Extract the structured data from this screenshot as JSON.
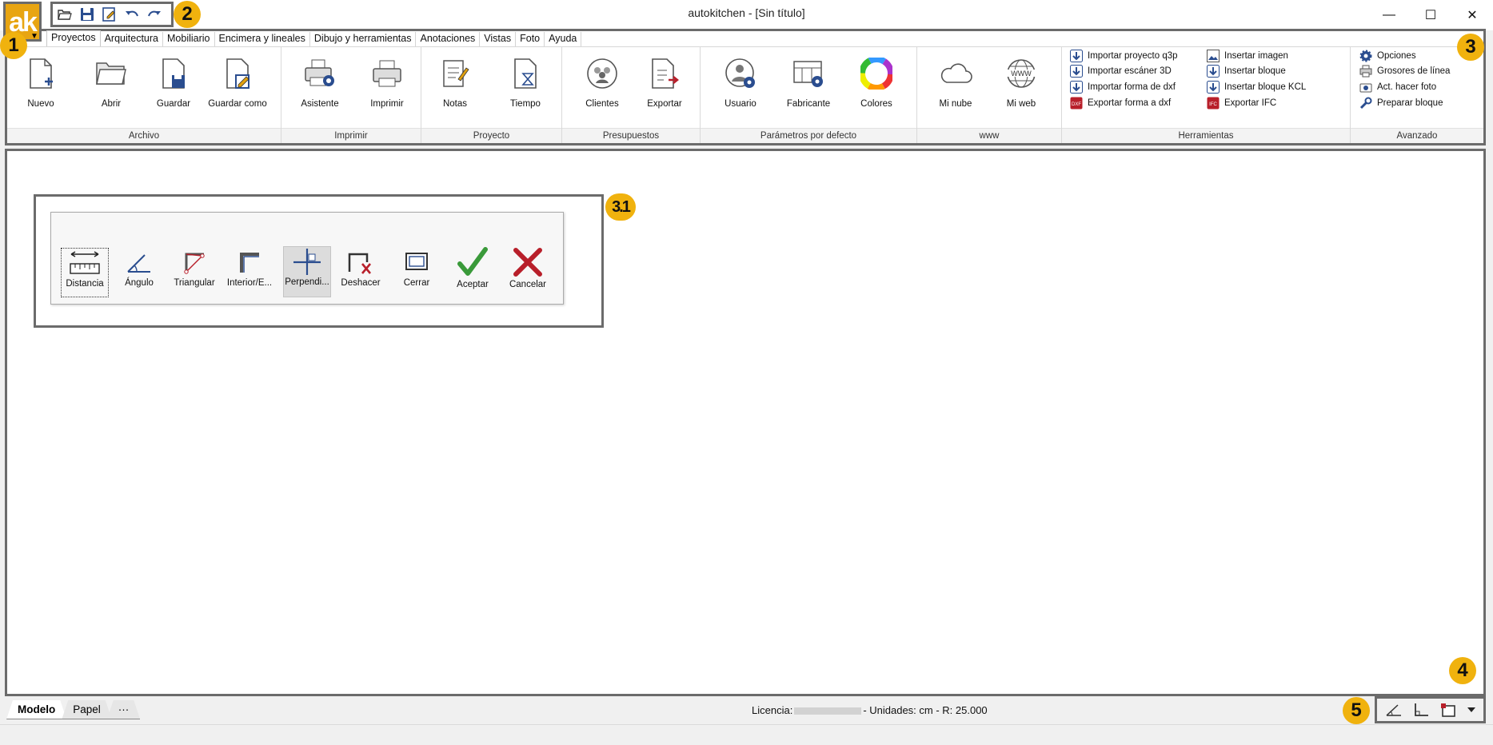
{
  "app": {
    "logo_text": "ak",
    "window_title": "autokitchen - [Sin título]"
  },
  "window_controls": {
    "minimize": "—",
    "maximize": "☐",
    "close": "✕"
  },
  "badges": {
    "b1": "1",
    "b2": "2",
    "b3": "3",
    "b31": "3.1",
    "b4": "4",
    "b5": "5"
  },
  "tabs": [
    "Proyectos",
    "Arquitectura",
    "Mobiliario",
    "Encimera y lineales",
    "Dibujo y herramientas",
    "Anotaciones",
    "Vistas",
    "Foto",
    "Ayuda"
  ],
  "ribbon": {
    "archivo": {
      "label": "Archivo",
      "nuevo": "Nuevo",
      "abrir": "Abrir",
      "guardar": "Guardar",
      "guardar_como": "Guardar como"
    },
    "imprimir": {
      "label": "Imprimir",
      "asistente": "Asistente",
      "imprimir": "Imprimir"
    },
    "proyecto": {
      "label": "Proyecto",
      "notas": "Notas",
      "tiempo": "Tiempo"
    },
    "presupuestos": {
      "label": "Presupuestos",
      "clientes": "Clientes",
      "exportar": "Exportar"
    },
    "parametros": {
      "label": "Parámetros por defecto",
      "usuario": "Usuario",
      "fabricante": "Fabricante",
      "colores": "Colores"
    },
    "www": {
      "label": "www",
      "mi_nube": "Mi nube",
      "mi_web": "Mi web"
    },
    "herramientas": {
      "label": "Herramientas",
      "items": [
        "Importar proyecto q3p",
        "Importar escáner 3D",
        "Importar forma de dxf",
        "Exportar forma a dxf",
        "Insertar imagen",
        "Insertar bloque",
        "Insertar bloque KCL",
        "Exportar IFC"
      ]
    },
    "avanzado": {
      "label": "Avanzado",
      "items": [
        "Opciones",
        "Grosores de línea",
        "Act. hacer foto",
        "Preparar bloque"
      ]
    }
  },
  "palette": {
    "distancia": "Distancia",
    "angulo": "Ángulo",
    "triangular": "Triangular",
    "interior": "Interior/E...",
    "perpendicular": "Perpendi...",
    "deshacer": "Deshacer",
    "cerrar": "Cerrar",
    "aceptar": "Aceptar",
    "cancelar": "Cancelar"
  },
  "sheets": [
    "Modelo",
    "Papel",
    "···"
  ],
  "status": {
    "licencia_label": "Licencia:",
    "units_text": "- Unidades: cm - R: 25.000"
  },
  "colors": {
    "accent": "#f0b20e",
    "frame": "#6b6b6b",
    "icon_blue": "#2a4d8f",
    "accept_green": "#3a9a3a",
    "cancel_red": "#b81f2a"
  }
}
